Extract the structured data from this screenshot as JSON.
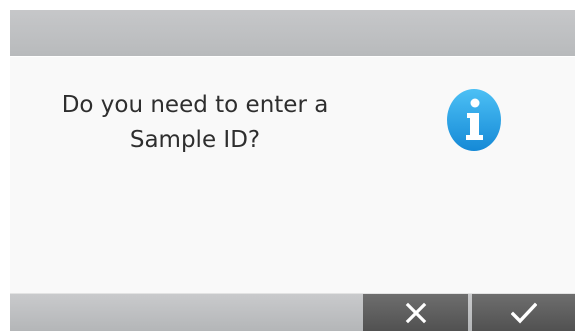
{
  "dialog": {
    "message_line1": "Do you need to enter a",
    "message_line2": "Sample ID?",
    "icon": "info-icon"
  },
  "buttons": {
    "cancel_icon": "close-icon",
    "confirm_icon": "check-icon"
  },
  "colors": {
    "info_blue": "#1ea3e6",
    "button_bg": "#5e5e5e",
    "bar_gray": "#c0c2c4"
  }
}
